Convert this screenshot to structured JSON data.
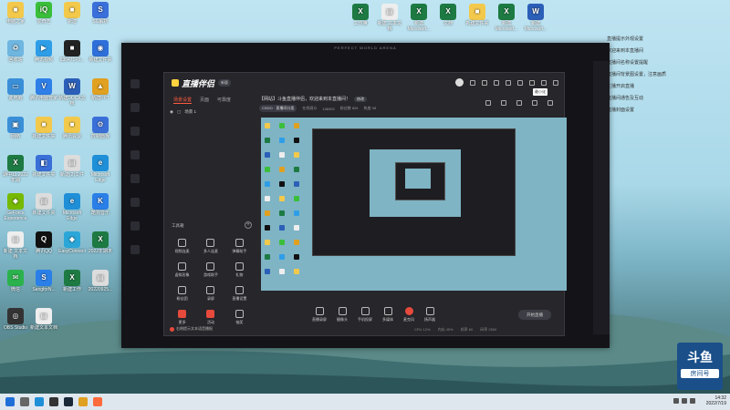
{
  "desktop": {
    "left_icons": [
      {
        "label": "电脑之家",
        "color": "#f3c94c",
        "glyph": "■"
      },
      {
        "label": "爱奇艺",
        "color": "#3bbf3b",
        "glyph": "iQ"
      },
      {
        "label": "新建",
        "color": "#f3c94c",
        "glyph": "■"
      },
      {
        "label": "SG解析",
        "color": "#3b6fd9",
        "glyph": "S"
      },
      {
        "label": "回收站",
        "color": "#6fb6e0",
        "glyph": "♻"
      },
      {
        "label": "腾讯视频",
        "color": "#2f9ee8",
        "glyph": "▶"
      },
      {
        "label": "636471F5...",
        "color": "#222",
        "glyph": "■"
      },
      {
        "label": "新建文件夹",
        "color": "#2e6fd9",
        "glyph": "◉"
      },
      {
        "label": "此电脑",
        "color": "#3a8fd8",
        "glyph": "▭"
      },
      {
        "label": "腾讯电脑管家",
        "color": "#2f7fe8",
        "glyph": "V"
      },
      {
        "label": "新建DOCX文档",
        "color": "#2b5fb8",
        "glyph": "W"
      },
      {
        "label": "新建PPT",
        "color": "#e0a020",
        "glyph": "▲"
      },
      {
        "label": "网络",
        "color": "#3a8fd8",
        "glyph": "▣"
      },
      {
        "label": "新建文件夹",
        "color": "#f3c94c",
        "glyph": "■"
      },
      {
        "label": "腾讯会议",
        "color": "#f3c94c",
        "glyph": "■"
      },
      {
        "label": "控制面板",
        "color": "#3a6fd8",
        "glyph": "⚙"
      },
      {
        "label": "期中11 2022年期",
        "color": "#1d7a42",
        "glyph": "X"
      },
      {
        "label": "新建文件夹",
        "color": "#3a6fd8",
        "glyph": "◧"
      },
      {
        "label": "新建(2)文件",
        "color": "#ddd",
        "glyph": "▤"
      },
      {
        "label": "Microsoft Edge",
        "color": "#1f8fd8",
        "glyph": "e"
      },
      {
        "label": "GeForce Experience",
        "color": "#76b900",
        "glyph": "◆"
      },
      {
        "label": "新建文件夹",
        "color": "#ddd",
        "glyph": "▤"
      },
      {
        "label": "Microsoft Edge",
        "color": "#1f8fd8",
        "glyph": "e"
      },
      {
        "label": "酷狗音乐",
        "color": "#2a7fe8",
        "glyph": "K"
      },
      {
        "label": "新建 文本文档",
        "color": "#eee",
        "glyph": "▤"
      },
      {
        "label": "腾讯QQ",
        "color": "#111",
        "glyph": "Q"
      },
      {
        "label": "EasyConnect",
        "color": "#2aa7d8",
        "glyph": "◆"
      },
      {
        "label": "2022年期末",
        "color": "#1d7a42",
        "glyph": "X"
      },
      {
        "label": "微信",
        "color": "#2bb24c",
        "glyph": "✉"
      },
      {
        "label": "SangforN...",
        "color": "#2a7fe8",
        "glyph": "S"
      },
      {
        "label": "新建工作",
        "color": "#1d7a42",
        "glyph": "X"
      },
      {
        "label": "20220925...",
        "color": "#ddd",
        "glyph": "▤"
      },
      {
        "label": "OBS Studio",
        "color": "#333",
        "glyph": "◎"
      },
      {
        "label": "新建文本文档",
        "color": "#eee",
        "glyph": "▤"
      }
    ],
    "top_icons": [
      {
        "label": "工作簿",
        "color": "#1d7a42",
        "glyph": "X"
      },
      {
        "label": "新建 文本文档",
        "color": "#eee",
        "glyph": "▤"
      },
      {
        "label": "新建 Microsoft...",
        "color": "#1d7a42",
        "glyph": "X"
      },
      {
        "label": "文档",
        "color": "#1d7a42",
        "glyph": "X"
      },
      {
        "label": "新建文件夹",
        "color": "#f3c94c",
        "glyph": "■"
      },
      {
        "label": "新建 Microsoft...",
        "color": "#1d7a42",
        "glyph": "X"
      },
      {
        "label": "新建 Microsoft...",
        "color": "#2b5fb8",
        "glyph": "W"
      }
    ],
    "right_notes": [
      "直播提示外观设置",
      "欢迎来到本直播间",
      "直播间名称设置提醒",
      "直播间背景图设置，注意画质",
      "主播开启直播",
      "直播间通告及互动",
      "直播封面设置"
    ],
    "watermark": {
      "big": "斗鱼",
      "small": "房间号"
    }
  },
  "taskbar": {
    "time": "14:32",
    "date": "2022/7/19"
  },
  "outer_window": {
    "title": "PERFECT WORLD ARENA"
  },
  "app": {
    "logo_text": "直播伴侣",
    "logo_badge": "新版",
    "tooltip": "最小化",
    "tabs": [
      "场景设置",
      "页面",
      "可靠度"
    ],
    "scene_label": "场景 1",
    "tools_title": "工具箱",
    "tools": [
      {
        "label": "视频连麦",
        "red": false
      },
      {
        "label": "多人连麦",
        "red": false
      },
      {
        "label": "弹幕助手",
        "red": false
      },
      {
        "label": "虚拟形象",
        "red": false
      },
      {
        "label": "游戏助手",
        "red": false
      },
      {
        "label": "礼物",
        "red": false
      },
      {
        "label": "粉丝团",
        "red": false
      },
      {
        "label": "录屏",
        "red": false
      },
      {
        "label": "直播设置",
        "red": false
      },
      {
        "label": "更多",
        "red": true
      },
      {
        "label": "活动",
        "red": true
      },
      {
        "label": "抽奖",
        "red": false
      }
    ],
    "left_footer": "右侧提示文本语音播报",
    "room_title": "【网站】斗鱼直播伴侣，欢迎来到本直播间！",
    "room_tag": "修改",
    "room_category": "CSGO · 直播间分类",
    "room_meta": [
      "在线观众",
      "158392",
      "粉丝数 826",
      "热度 98"
    ],
    "bottom_buttons": [
      {
        "label": "直播录屏",
        "red": false
      },
      {
        "label": "摄像头",
        "red": false
      },
      {
        "label": "手机投屏",
        "red": false
      },
      {
        "label": "多媒体",
        "red": false
      },
      {
        "label": "麦克风",
        "red": true
      },
      {
        "label": "扬声器",
        "red": false
      }
    ],
    "start_button": "开始直播",
    "status": [
      "CPU 12%",
      "内存 45%",
      "帧率 60",
      "码率 2500"
    ]
  },
  "colors": {
    "accent": "#ff5a3c",
    "app_bg": "#26262b",
    "outer_bg": "#141418"
  }
}
